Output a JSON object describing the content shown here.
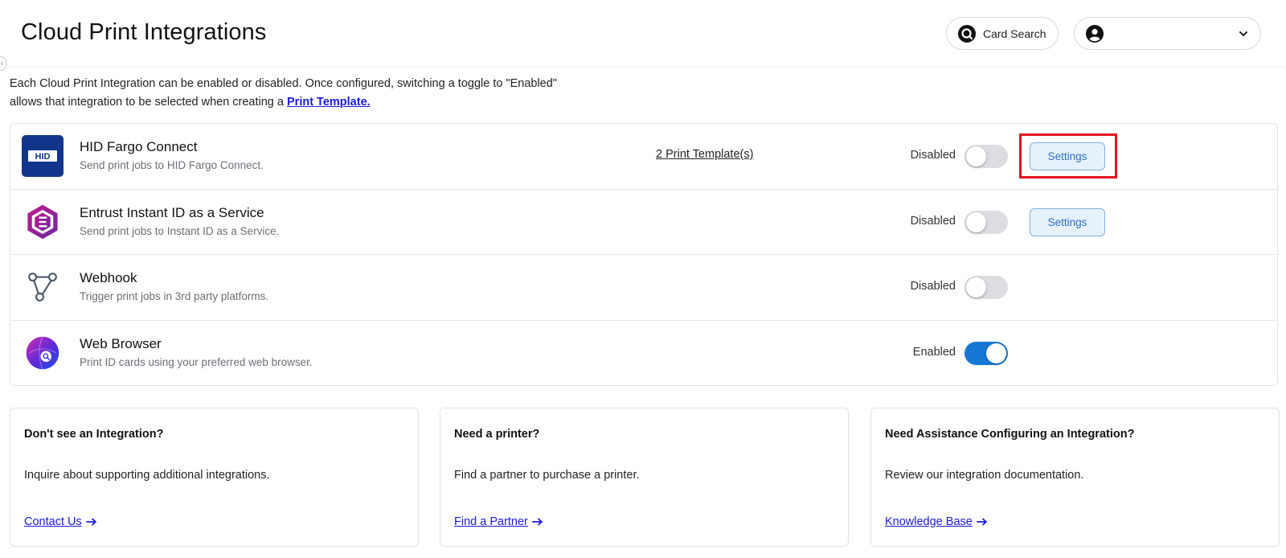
{
  "header": {
    "title": "Cloud Print Integrations",
    "card_search_label": "Card Search",
    "user_name": ""
  },
  "intro": {
    "line1": "Each Cloud Print Integration can be enabled or disabled. Once configured, switching a toggle to \"Enabled\"",
    "line2_prefix": "allows that integration to be selected when creating a ",
    "link_text": "Print Template."
  },
  "integrations": [
    {
      "name": "HID Fargo Connect",
      "description": "Send print jobs to HID Fargo Connect.",
      "templates_link": "2 Print Template(s)",
      "status": "Disabled",
      "enabled": false,
      "settings_label": "Settings",
      "logo": "hid-logo-icon"
    },
    {
      "name": "Entrust Instant ID as a Service",
      "description": "Send print jobs to Instant ID as a Service.",
      "status": "Disabled",
      "enabled": false,
      "settings_label": "Settings",
      "logo": "entrust-logo-icon"
    },
    {
      "name": "Webhook",
      "description": "Trigger print jobs in 3rd party platforms.",
      "status": "Disabled",
      "enabled": false,
      "logo": "webhook-icon"
    },
    {
      "name": "Web Browser",
      "description": "Print ID cards using your preferred web browser.",
      "status": "Enabled",
      "enabled": true,
      "logo": "web-browser-icon"
    }
  ],
  "cards": [
    {
      "title": "Don't see an Integration?",
      "text": "Inquire about supporting additional integrations.",
      "link": "Contact Us"
    },
    {
      "title": "Need a printer?",
      "text": "Find a partner to purchase a printer.",
      "link": "Find a Partner"
    },
    {
      "title": "Need Assistance Configuring an Integration?",
      "text": "Review our integration documentation.",
      "link": "Knowledge Base"
    }
  ],
  "colors": {
    "accent": "#1478d4",
    "link": "#1b1bd8",
    "highlight": "#e0151f",
    "settings_bg": "#e7f1fc"
  }
}
